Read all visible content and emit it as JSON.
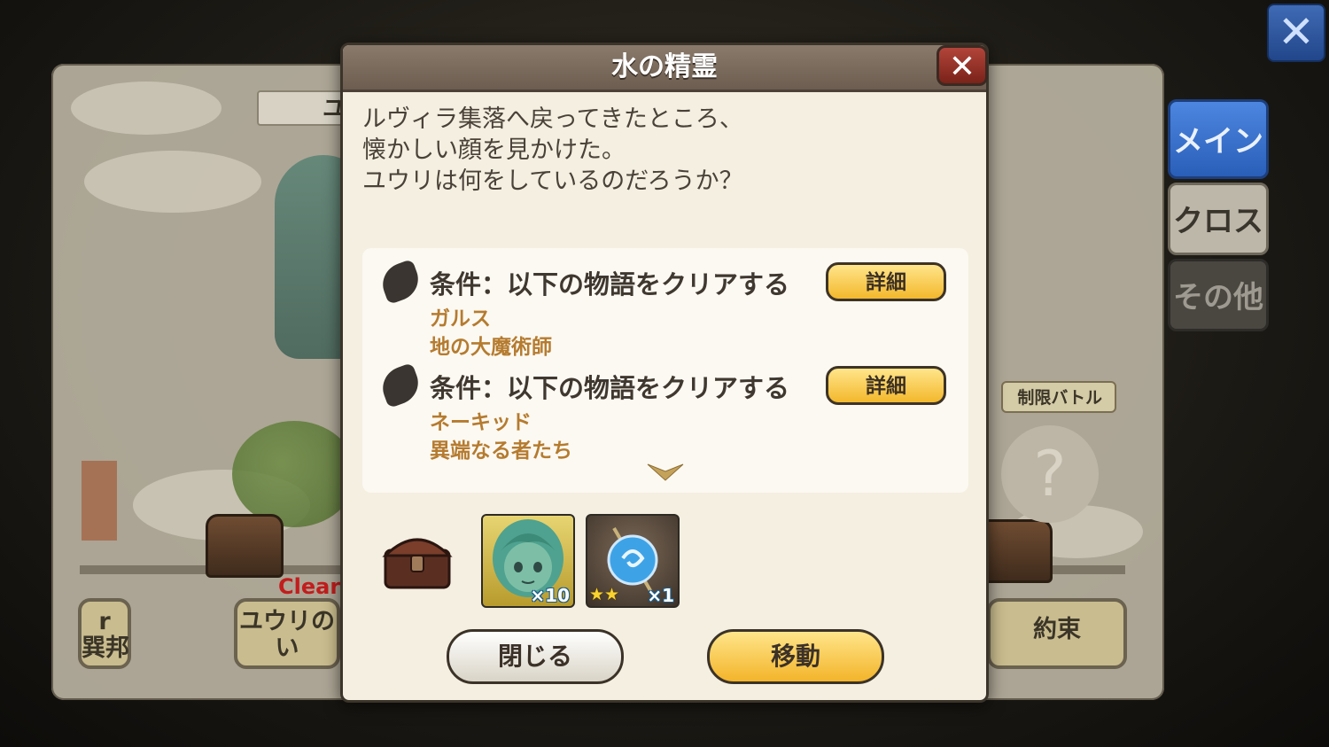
{
  "background": {
    "title_fragment": "ユ",
    "clear_label": "Clear",
    "left_node_label": "r\n巽邦",
    "node_yuuri_label": "ユウリの\nい",
    "node_promise_label": "約束",
    "limited_battle_label": "制限バトル",
    "unknown_mark": "?"
  },
  "side_tabs": {
    "main": "メイン",
    "cross": "クロス",
    "other": "その他"
  },
  "dialog": {
    "title": "水の精霊",
    "description_lines": [
      "ルヴィラ集落へ戻ってきたところ、",
      "懐かしい顔を見かけた。",
      "ユウリは何をしているのだろうか？"
    ],
    "conditions": [
      {
        "label": "条件：以下の物語をクリアする",
        "story_title": "ガルス",
        "story_chapter": "地の大魔術師",
        "detail_button": "詳細"
      },
      {
        "label": "条件：以下の物語をクリアする",
        "story_title": "ネーキッド",
        "story_chapter": "異端なる者たち",
        "detail_button": "詳細"
      }
    ],
    "rewards": [
      {
        "icon": "green-haired-spirit-portrait",
        "quantity": "×10"
      },
      {
        "icon": "blue-orb-item",
        "stars": "★★",
        "quantity": "×1"
      }
    ],
    "close_button": "閉じる",
    "move_button": "移動"
  }
}
